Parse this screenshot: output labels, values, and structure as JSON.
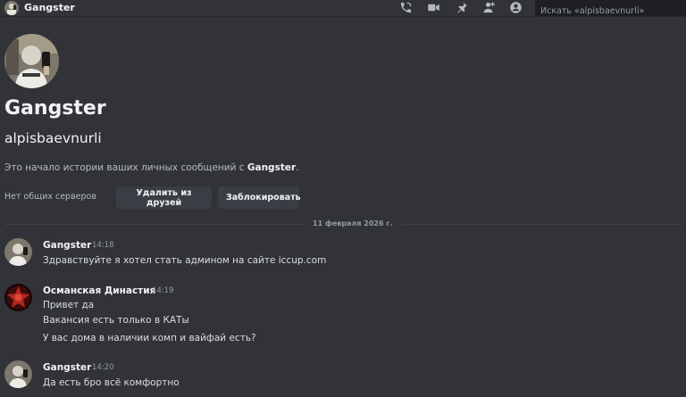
{
  "header": {
    "title": "Gangster",
    "icons": [
      "phone-call-icon",
      "video-call-icon",
      "pin-icon",
      "add-friends-icon",
      "user-profile-icon"
    ],
    "search_placeholder": "Искать «alpisbaevnurli»"
  },
  "profile": {
    "display_name": "Gangster",
    "username": "alpisbaevnurli",
    "intro_prefix": "Это начало истории ваших личных сообщений с ",
    "intro_name": "Gangster",
    "intro_suffix": ".",
    "no_servers": "Нет общих серверов",
    "remove_friend_label": "Удалить из друзей",
    "block_label": "Заблокировать"
  },
  "date_divider": "11 февраля 2026 г.",
  "messages": [
    {
      "author": "Gangster",
      "time": "14:18",
      "lines": [
        "Здравствуйте я хотел стать админом на сайте iccup.com"
      ]
    },
    {
      "author": "Османская Династия",
      "time": "14:19",
      "lines": [
        "Привет да",
        "Вакансия есть только в КАТы",
        "У вас дома в наличии комп и вайфай есть?"
      ]
    },
    {
      "author": "Gangster",
      "time": "14:20",
      "lines": [
        "Да есть бро всё комфортно"
      ]
    }
  ],
  "colors": {
    "background": "#313338",
    "text": "#dbdee1",
    "muted": "#949ba4",
    "button": "#3b3d44",
    "search_bg": "#1e1f22"
  }
}
